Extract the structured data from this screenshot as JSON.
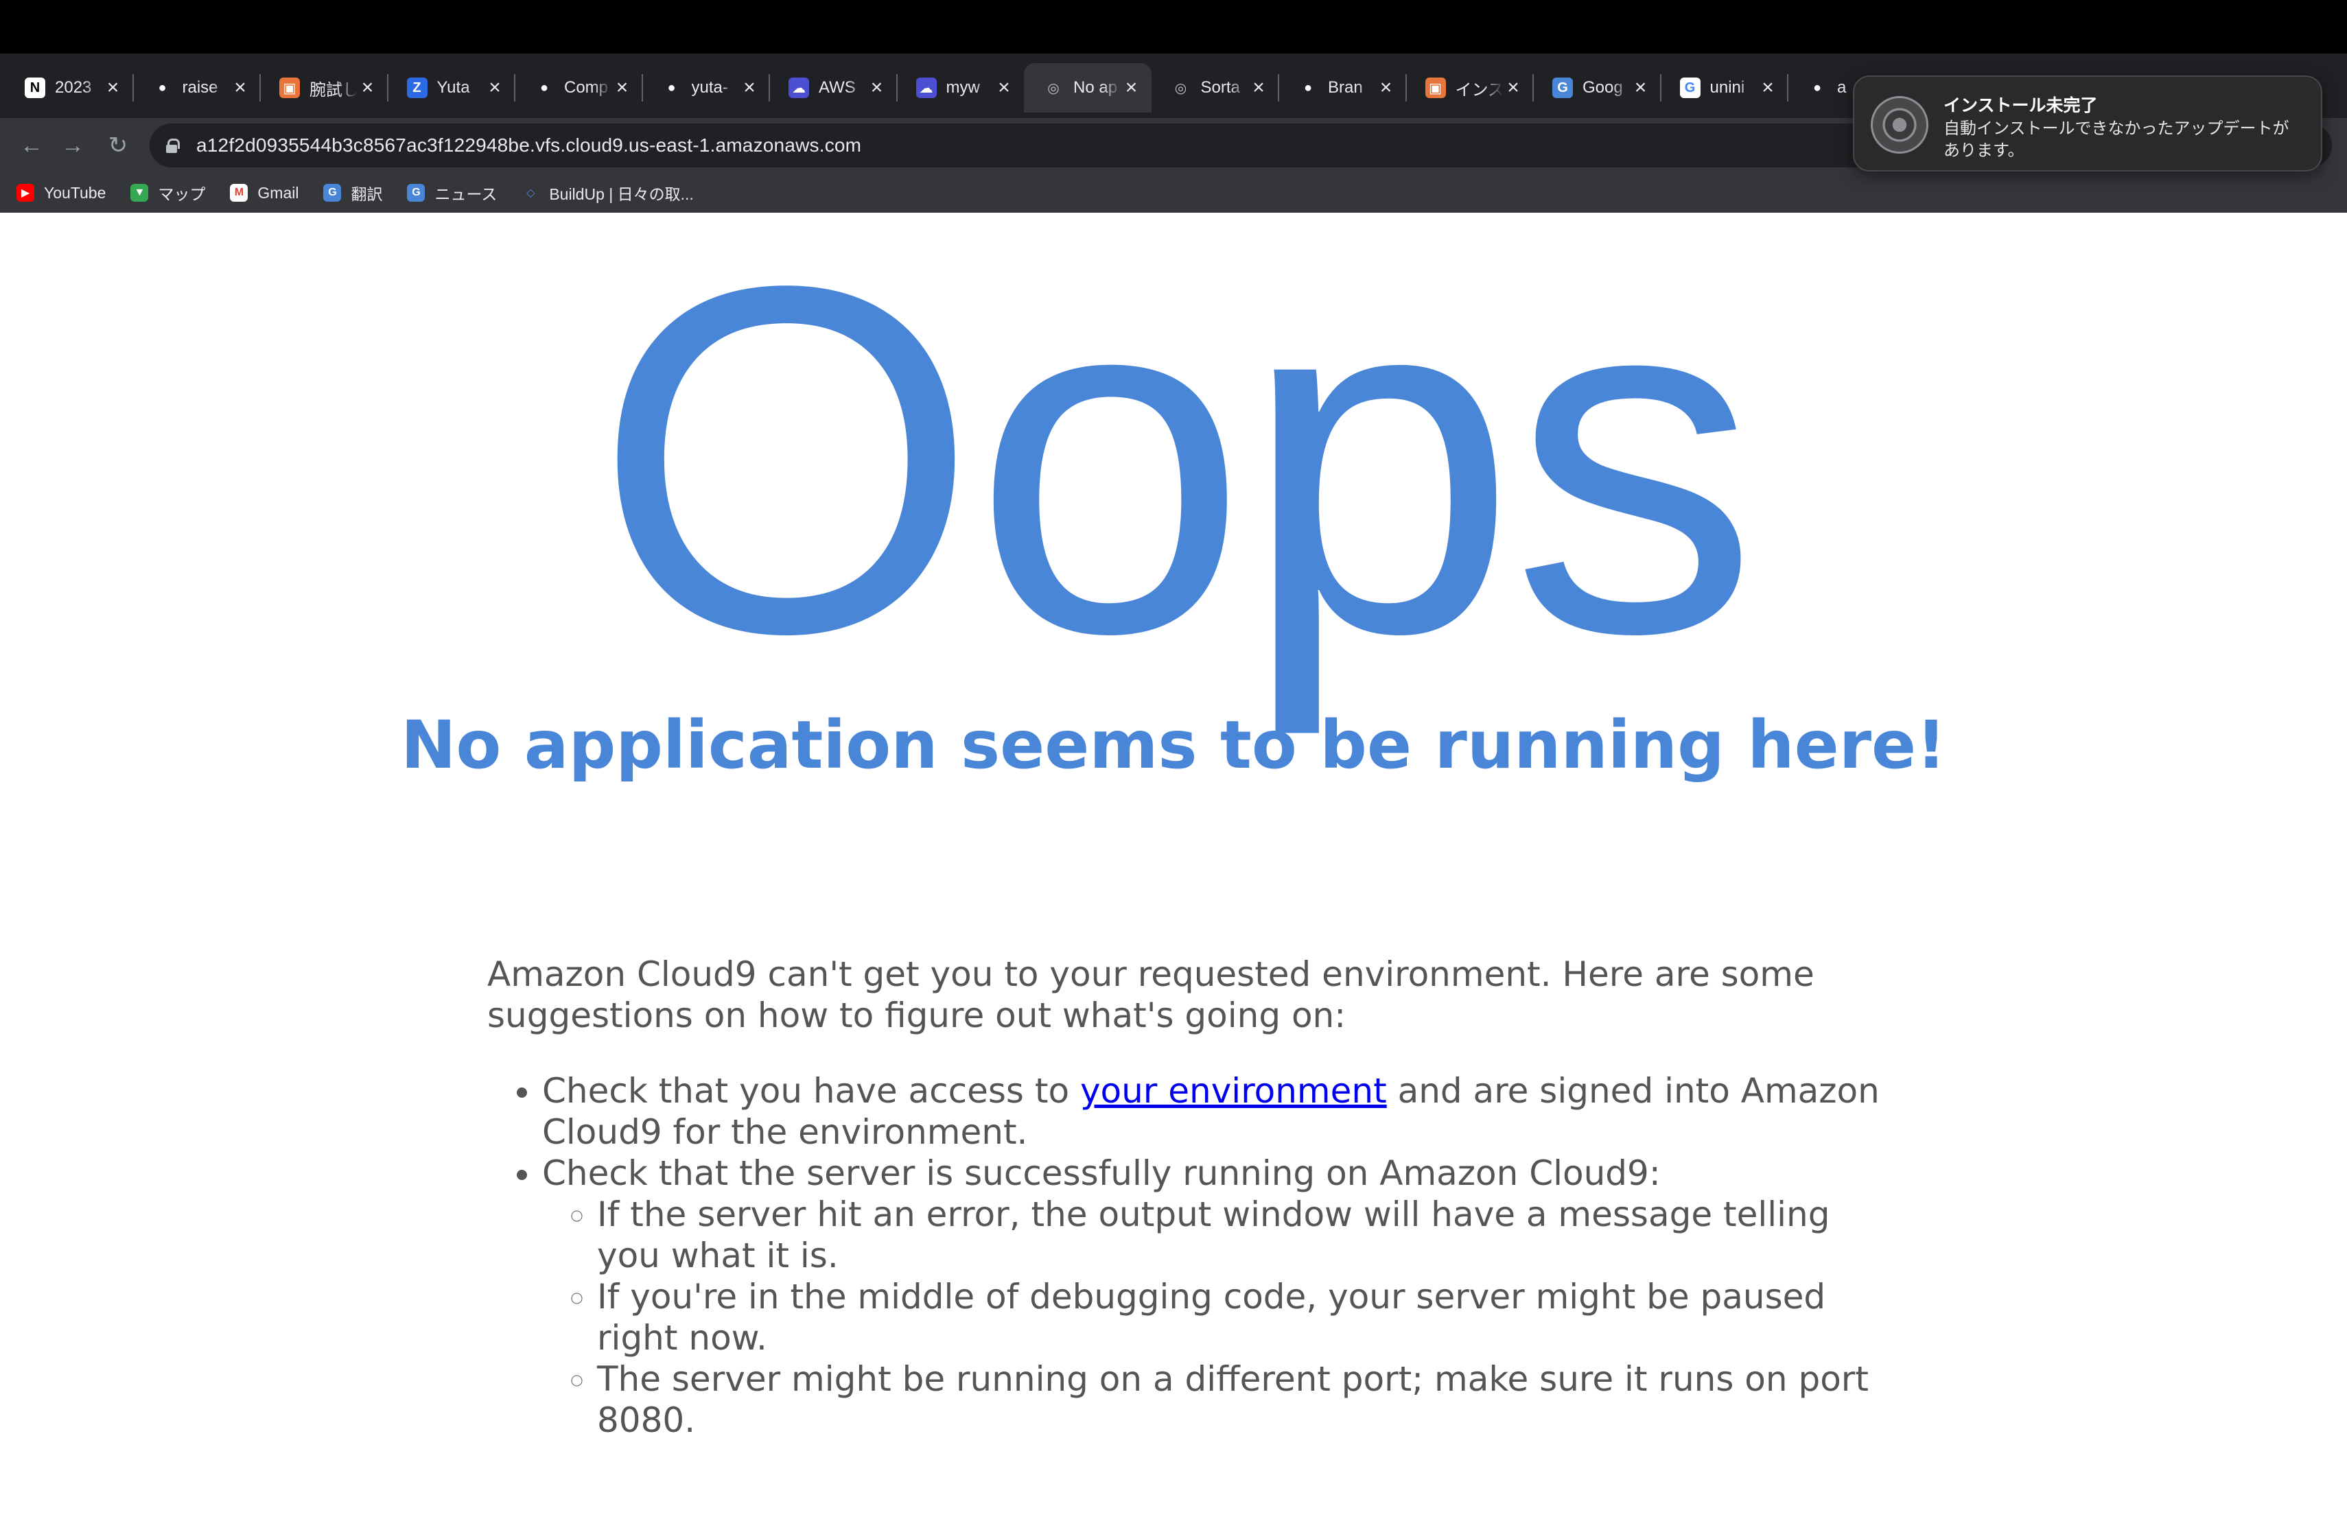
{
  "browser": {
    "tabs": [
      {
        "title": "2023",
        "icon": "notion-icon",
        "active": false
      },
      {
        "title": "raise",
        "icon": "github-icon",
        "active": false
      },
      {
        "title": "腕試し",
        "icon": "app-icon",
        "active": false
      },
      {
        "title": "Yuta",
        "icon": "z-icon",
        "active": false
      },
      {
        "title": "Comp",
        "icon": "github-icon",
        "active": false
      },
      {
        "title": "yuta-",
        "icon": "github-icon",
        "active": false
      },
      {
        "title": "AWS",
        "icon": "cloud9-icon",
        "active": false
      },
      {
        "title": "myw",
        "icon": "cloud9-icon",
        "active": false
      },
      {
        "title": "No ap",
        "icon": "globe-icon",
        "active": true
      },
      {
        "title": "Sorta",
        "icon": "globe-icon",
        "active": false
      },
      {
        "title": "Bran",
        "icon": "github-icon",
        "active": false
      },
      {
        "title": "インス",
        "icon": "app-icon",
        "active": false
      },
      {
        "title": "Goog",
        "icon": "translate-icon",
        "active": false
      },
      {
        "title": "unini",
        "icon": "google-icon",
        "active": false
      },
      {
        "title": "a",
        "icon": "github-icon",
        "active": false
      }
    ],
    "url": "a12f2d0935544b3c8567ac3f122948be.vfs.cloud9.us-east-1.amazonaws.com",
    "bookmarks": [
      {
        "label": "YouTube",
        "icon": "youtube-icon"
      },
      {
        "label": "マップ",
        "icon": "maps-icon"
      },
      {
        "label": "Gmail",
        "icon": "gmail-icon"
      },
      {
        "label": "翻訳",
        "icon": "translate-icon"
      },
      {
        "label": "ニュース",
        "icon": "news-icon"
      },
      {
        "label": "BuildUp | 日々の取...",
        "icon": "buildup-icon"
      }
    ]
  },
  "notification": {
    "title": "インストール未完了",
    "body": "自動インストールできなかったアップデートがあります。"
  },
  "page": {
    "headline": "Oops",
    "subtitle": "No application seems to be running here!",
    "intro": "Amazon Cloud9 can't get you to your requested environment. Here are some suggestions on how to figure out what's going on:",
    "item1_pre": "Check that you have access to ",
    "item1_link": "your environment",
    "item1_post": " and are signed into Amazon Cloud9 for the environment.",
    "item2": "Check that the server is successfully running on Amazon Cloud9:",
    "subitems": [
      "If the server hit an error, the output window will have a message telling you what it is.",
      "If you're in the middle of debugging code, your server might be paused right now.",
      "The server might be running on a different port; make sure it runs on port 8080."
    ]
  },
  "colors": {
    "accent": "#4a86d8",
    "link": "#0000ee",
    "body_text": "#555555",
    "chrome_dark": "#202124",
    "chrome_toolbar": "#35363a"
  }
}
